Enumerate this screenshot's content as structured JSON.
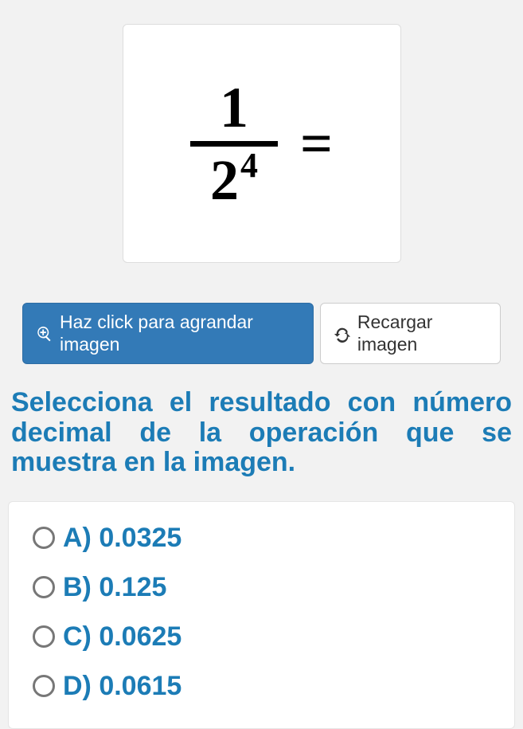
{
  "math": {
    "numerator": "1",
    "base": "2",
    "exponent": "4",
    "equals": "="
  },
  "buttons": {
    "enlarge": "Haz click para agrandar imagen",
    "reload": "Recargar imagen"
  },
  "question": "Selecciona el resultado con número decimal de la operación que se muestra en la imagen.",
  "options": [
    {
      "label": "A) 0.0325"
    },
    {
      "label": "B) 0.125"
    },
    {
      "label": "C) 0.0625"
    },
    {
      "label": "D) 0.0615"
    }
  ]
}
